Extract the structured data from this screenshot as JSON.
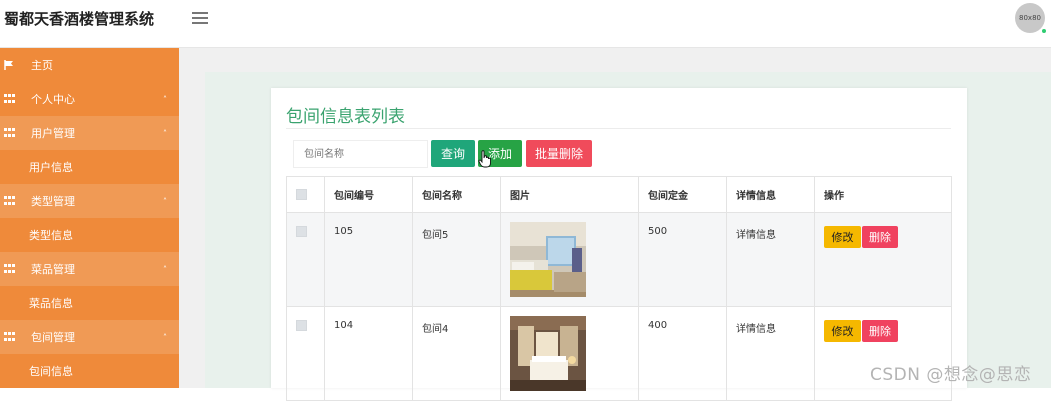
{
  "app": {
    "title": "蜀都天香酒楼管理系统"
  },
  "user": {
    "avatar_text": "80x80"
  },
  "sidebar": {
    "items": [
      {
        "label": "主页",
        "icon": "flag-icon",
        "type": "item"
      },
      {
        "label": "个人中心",
        "icon": "grid-icon",
        "type": "group"
      },
      {
        "label": "用户管理",
        "icon": "grid-icon",
        "type": "group"
      },
      {
        "label": "用户信息",
        "type": "sub"
      },
      {
        "label": "类型管理",
        "icon": "grid-icon",
        "type": "group"
      },
      {
        "label": "类型信息",
        "type": "sub"
      },
      {
        "label": "菜品管理",
        "icon": "grid-icon",
        "type": "group"
      },
      {
        "label": "菜品信息",
        "type": "sub"
      },
      {
        "label": "包间管理",
        "icon": "grid-icon",
        "type": "group"
      },
      {
        "label": "包间信息",
        "type": "sub"
      }
    ],
    "caret": "˄"
  },
  "main": {
    "title": "包间信息表列表",
    "search": {
      "placeholder": "包间名称",
      "value": ""
    },
    "buttons": {
      "query": "查询",
      "add": "添加",
      "batch_delete": "批量删除"
    },
    "table": {
      "headers": [
        "包间编号",
        "包间名称",
        "图片",
        "包间定金",
        "详情信息",
        "操作"
      ],
      "rows": [
        {
          "id": "105",
          "name": "包间5",
          "deposit": "500",
          "detail": "详情信息",
          "edit": "修改",
          "delete": "删除"
        },
        {
          "id": "104",
          "name": "包间4",
          "deposit": "400",
          "detail": "详情信息",
          "edit": "修改",
          "delete": "删除"
        }
      ]
    }
  },
  "watermark": "CSDN @想念@思恋",
  "colors": {
    "sidebar": "#ef8a3a",
    "sidebar_group": "#f09a55",
    "title": "#3aa36f",
    "query": "#1fa67a",
    "add": "#27a345",
    "delete": "#f04b5b",
    "edit": "#f5b800"
  }
}
